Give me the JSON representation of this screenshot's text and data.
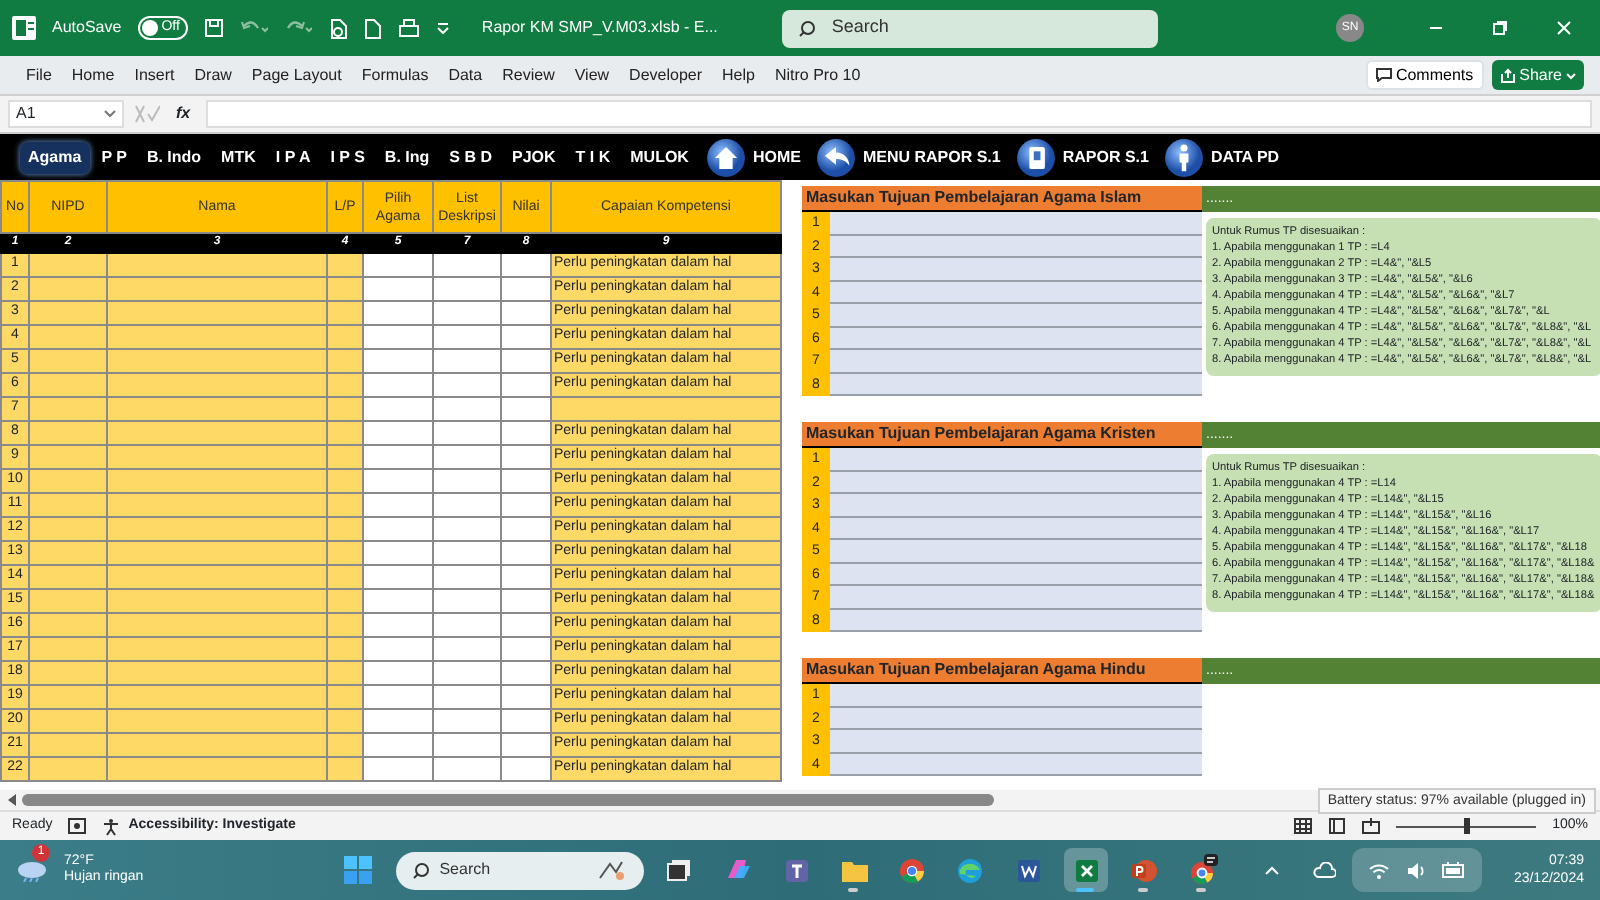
{
  "title_bar": {
    "autosave_label": "AutoSave",
    "autosave": {
      "on": false,
      "label": "Off"
    },
    "file_title": "Rapor KM SMP_V.M03.xlsb  -  E...",
    "search_placeholder": "Search",
    "user_initials": "SN"
  },
  "ribbon_tabs": [
    "File",
    "Home",
    "Insert",
    "Draw",
    "Page Layout",
    "Formulas",
    "Data",
    "Review",
    "View",
    "Developer",
    "Help",
    "Nitro Pro 10"
  ],
  "ribbon_buttons": {
    "comments": "Comments",
    "share": "Share"
  },
  "formula_bar": {
    "name_box": "A1",
    "fx": "fx"
  },
  "sheet_nav": {
    "subjects": [
      {
        "label": "Agama",
        "selected": true
      },
      {
        "label": "P P",
        "selected": false
      },
      {
        "label": "B. Indo",
        "selected": false
      },
      {
        "label": "MTK",
        "selected": false
      },
      {
        "label": "I P A",
        "selected": false
      },
      {
        "label": "I P S",
        "selected": false
      },
      {
        "label": "B. Ing",
        "selected": false
      },
      {
        "label": "S B D",
        "selected": false
      },
      {
        "label": "PJOK",
        "selected": false
      },
      {
        "label": "T I K",
        "selected": false
      },
      {
        "label": "MULOK",
        "selected": false
      }
    ],
    "links": [
      {
        "label": "HOME",
        "kind": "home"
      },
      {
        "label": "MENU RAPOR S.1",
        "kind": "back"
      },
      {
        "label": "RAPOR S.1",
        "kind": "door"
      },
      {
        "label": "DATA PD",
        "kind": "person"
      }
    ]
  },
  "grade_table": {
    "columns": [
      {
        "label": "No",
        "number": "1",
        "kind": "yellow"
      },
      {
        "label": "NIPD",
        "number": "2",
        "kind": "yellow"
      },
      {
        "label": "Nama",
        "number": "3",
        "kind": "yellow"
      },
      {
        "label": "L/P",
        "number": "4",
        "kind": "yellow"
      },
      {
        "label": "Pilih Agama",
        "number": "5",
        "kind": "white"
      },
      {
        "label": "List Deskripsi",
        "number": "7",
        "kind": "white"
      },
      {
        "label": "Nilai",
        "number": "8",
        "kind": "white"
      },
      {
        "label": "Capaian Kompetensi",
        "number": "9",
        "kind": "yellow"
      }
    ],
    "rows": [
      {
        "no": "1",
        "capaian": "Perlu peningkatan dalam hal"
      },
      {
        "no": "2",
        "capaian": "Perlu peningkatan dalam hal"
      },
      {
        "no": "3",
        "capaian": "Perlu peningkatan dalam hal"
      },
      {
        "no": "4",
        "capaian": "Perlu peningkatan dalam hal"
      },
      {
        "no": "5",
        "capaian": "Perlu peningkatan dalam hal"
      },
      {
        "no": "6",
        "capaian": "Perlu peningkatan dalam hal"
      },
      {
        "no": "7"
      },
      {
        "no": "8",
        "capaian": "Perlu peningkatan dalam hal"
      },
      {
        "no": "9",
        "capaian": "Perlu peningkatan dalam hal"
      },
      {
        "no": "10",
        "capaian": "Perlu peningkatan dalam hal"
      },
      {
        "no": "11",
        "capaian": "Perlu peningkatan dalam hal"
      },
      {
        "no": "12",
        "capaian": "Perlu peningkatan dalam hal"
      },
      {
        "no": "13",
        "capaian": "Perlu peningkatan dalam hal"
      },
      {
        "no": "14",
        "capaian": "Perlu peningkatan dalam hal"
      },
      {
        "no": "15",
        "capaian": "Perlu peningkatan dalam hal"
      },
      {
        "no": "16",
        "capaian": "Perlu peningkatan dalam hal"
      },
      {
        "no": "17",
        "capaian": "Perlu peningkatan dalam hal"
      },
      {
        "no": "18",
        "capaian": "Perlu peningkatan dalam hal"
      },
      {
        "no": "19",
        "capaian": "Perlu peningkatan dalam hal"
      },
      {
        "no": "20",
        "capaian": "Perlu peningkatan dalam hal"
      },
      {
        "no": "21",
        "capaian": "Perlu peningkatan dalam hal"
      },
      {
        "no": "22",
        "capaian": "Perlu peningkatan dalam hal"
      }
    ]
  },
  "tp_sections": [
    {
      "title": "Masukan Tujuan Pembelajaran Agama Islam",
      "filler": ".......",
      "rows": [
        "1",
        "2",
        "3",
        "4",
        "5",
        "6",
        "7",
        "8"
      ],
      "note": [
        "Untuk Rumus TP disesuaikan :",
        "1. Apabila menggunakan 1 TP : =L4",
        "2. Apabila menggunakan 2 TP : =L4&\", \"&L5",
        "3. Apabila menggunakan 3 TP : =L4&\", \"&L5&\", \"&L6",
        "4. Apabila menggunakan 4 TP : =L4&\", \"&L5&\", \"&L6&\", \"&L7",
        "5. Apabila menggunakan 4 TP : =L4&\", \"&L5&\", \"&L6&\", \"&L7&\", \"&L",
        "6. Apabila menggunakan 4 TP : =L4&\", \"&L5&\", \"&L6&\", \"&L7&\", \"&L8&\", \"&L",
        "7. Apabila menggunakan 4 TP : =L4&\", \"&L5&\", \"&L6&\", \"&L7&\", \"&L8&\", \"&L",
        "8. Apabila menggunakan 4 TP : =L4&\", \"&L5&\", \"&L6&\", \"&L7&\", \"&L8&\", \"&L"
      ]
    },
    {
      "title": "Masukan Tujuan Pembelajaran Agama Kristen",
      "filler": ".......",
      "rows": [
        "1",
        "2",
        "3",
        "4",
        "5",
        "6",
        "7",
        "8"
      ],
      "note": [
        "Untuk Rumus TP disesuaikan :",
        "1. Apabila menggunakan 4 TP : =L14",
        "2. Apabila menggunakan 4 TP : =L14&\", \"&L15",
        "3. Apabila menggunakan 4 TP : =L14&\", \"&L15&\", \"&L16",
        "4. Apabila menggunakan 4 TP : =L14&\", \"&L15&\", \"&L16&\", \"&L17",
        "5. Apabila menggunakan 4 TP : =L14&\", \"&L15&\", \"&L16&\", \"&L17&\", \"&L18",
        "6. Apabila menggunakan 4 TP : =L14&\", \"&L15&\", \"&L16&\", \"&L17&\", \"&L18&",
        "7. Apabila menggunakan 4 TP : =L14&\", \"&L15&\", \"&L16&\", \"&L17&\", \"&L18&",
        "8. Apabila menggunakan 4 TP : =L14&\", \"&L15&\", \"&L16&\", \"&L17&\", \"&L18&"
      ]
    },
    {
      "title": "Masukan Tujuan Pembelajaran Agama Hindu",
      "filler": ".......",
      "rows": [
        "1",
        "2",
        "3",
        "4"
      ]
    }
  ],
  "status_bar": {
    "ready": "Ready",
    "accessibility": "Accessibility: Investigate",
    "zoom": "100%",
    "level": 0.5
  },
  "tooltip": "Battery status: 97% available (plugged in)",
  "taskbar": {
    "weather": {
      "badge": "1",
      "temp": "72°F",
      "desc": "Hujan ringan"
    },
    "search_placeholder": "Search",
    "apps": [
      {
        "kind": "taskview",
        "running": false,
        "active": false
      },
      {
        "kind": "copilot",
        "running": false,
        "active": false
      },
      {
        "kind": "teams",
        "running": false,
        "active": false
      },
      {
        "kind": "folder",
        "running": true,
        "active": false
      },
      {
        "kind": "chrome",
        "running": false,
        "active": false
      },
      {
        "kind": "edge",
        "running": false,
        "active": false
      },
      {
        "kind": "word",
        "running": false,
        "active": false
      },
      {
        "kind": "excel",
        "running": true,
        "active": true
      },
      {
        "kind": "powerpoint",
        "running": true,
        "active": false
      },
      {
        "kind": "chrome-chat",
        "running": true,
        "active": false
      }
    ],
    "time": "07:39",
    "date": "23/12/2024"
  }
}
